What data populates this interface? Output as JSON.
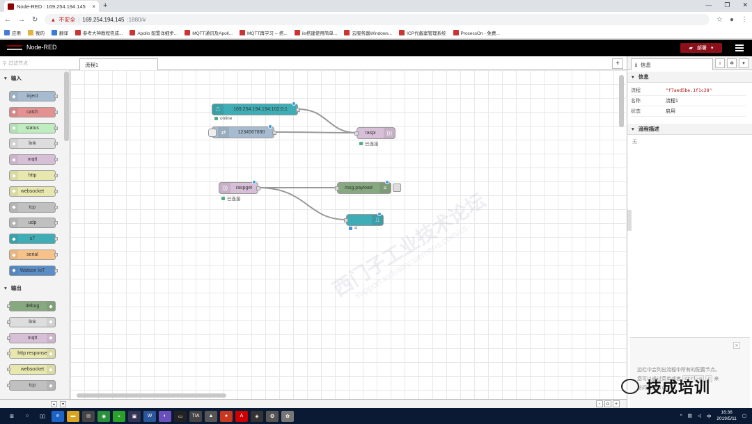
{
  "browser": {
    "tab_title": "Node-RED : 169.254.194.145",
    "new_tab": "+",
    "address": {
      "warning": "不安全",
      "host": "169.254.194.145",
      "rest": ":1880/#"
    },
    "bookmarks": [
      "应用",
      "我的",
      "翻译",
      "参考大神教程完成...",
      "Apollo 配置详细步...",
      "MQTT通讯及Apoll...",
      "MQTT再学习 -- 搭...",
      "iis搭建使用简单...",
      "云服务器Windows...",
      "ICP代备案管理系统",
      "ProcessOn - 免费..."
    ]
  },
  "header": {
    "app_name": "Node-RED",
    "deploy_label": "部署"
  },
  "palette": {
    "search_placeholder": "过滤节点",
    "categories": [
      {
        "label": "输入"
      },
      {
        "label": "输出"
      }
    ],
    "input_nodes": [
      {
        "label": "inject",
        "color": "#a6bbcf"
      },
      {
        "label": "catch",
        "color": "#e49191"
      },
      {
        "label": "status",
        "color": "#c0edc0"
      },
      {
        "label": "link",
        "color": "#dddddd"
      },
      {
        "label": "mqtt",
        "color": "#d8bfd8"
      },
      {
        "label": "http",
        "color": "#e7e7ae"
      },
      {
        "label": "websocket",
        "color": "#e7e7ae"
      },
      {
        "label": "tcp",
        "color": "#c0c0c0"
      },
      {
        "label": "udp",
        "color": "#c0c0c0"
      },
      {
        "label": "s7",
        "color": "#3fadb5"
      },
      {
        "label": "serial",
        "color": "#f7c28a"
      },
      {
        "label": "Watson IoT",
        "color": "#5b8ec8"
      }
    ],
    "output_nodes": [
      {
        "label": "debug",
        "color": "#87a980"
      },
      {
        "label": "link",
        "color": "#dddddd"
      },
      {
        "label": "mqtt",
        "color": "#d8bfd8"
      },
      {
        "label": "http response",
        "color": "#e7e7ae"
      },
      {
        "label": "websocket",
        "color": "#e7e7ae"
      },
      {
        "label": "tcp",
        "color": "#c0c0c0"
      }
    ]
  },
  "workspace": {
    "tab_label": "流程1",
    "add_tab": "+",
    "nodes": {
      "s7in": {
        "label": "169.254.194.194:102:0:1",
        "status": "online",
        "color": "#3fadb5"
      },
      "inject": {
        "label": "1234567890",
        "color": "#a6bbcf"
      },
      "raspi": {
        "label": "raspi",
        "status": "已连接",
        "color": "#d8bfd8"
      },
      "raspget": {
        "label": "raspget",
        "status": "已连接",
        "color": "#d8bfd8"
      },
      "debug": {
        "label": "msg.payload",
        "color": "#87a980"
      },
      "s7out": {
        "label": "",
        "status": "4",
        "color": "#3fadb5"
      }
    },
    "watermark": "西门子工业技术论坛",
    "watermark_url": "support.industry.siemens.com/cs",
    "zoom_buttons": [
      "-",
      "o",
      "+"
    ]
  },
  "sidebar": {
    "tab_label": "信息",
    "section_info": "信息",
    "rows": [
      {
        "key": "流程",
        "value": "\"f7aed5be.1f1c28\""
      },
      {
        "key": "名称",
        "value": "流程1"
      },
      {
        "key": "状态",
        "value": "启用"
      }
    ],
    "section_desc": "流程描述",
    "desc_placeholder": "无",
    "help_text_1": "边栏中会列出流程中所有的配置节点。",
    "help_text_2": "您可以通过菜单或者",
    "help_key_1": "ctrl-g",
    "help_key_2": "c",
    "help_text_3": "来",
    "help_text_4": "访问这些节点。"
  },
  "overlay": {
    "wechat_text": "技成培训"
  },
  "taskbar": {
    "time": "16:36",
    "date": "2019/5/11",
    "ime": "中"
  }
}
